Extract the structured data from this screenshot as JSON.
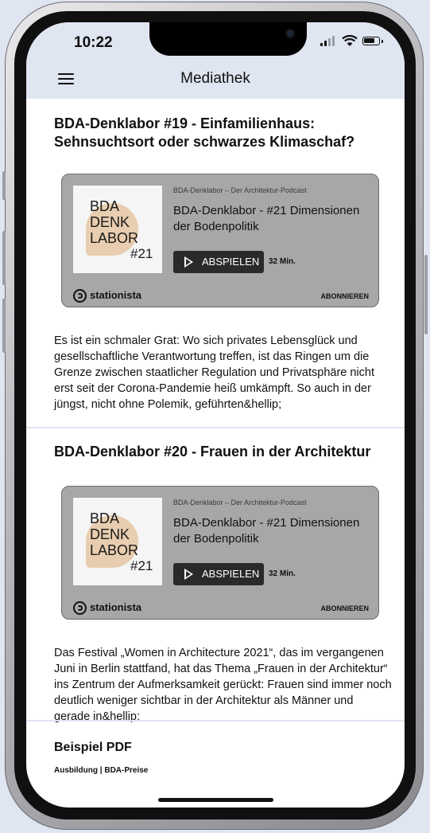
{
  "status_bar": {
    "time": "10:22",
    "battery_level": 0.75
  },
  "nav": {
    "title": "Mediathek",
    "menu_icon": "hamburger-menu-icon"
  },
  "podcast_embed": {
    "subtitle": "BDA-Denklabor – Der Architektur-Podcast",
    "episode_title": "BDA-Denklabor - #21 Dimensionen der Bodenpolitik",
    "cover_lines": [
      "BDA",
      "DENK",
      "LABOR"
    ],
    "cover_number": "#21",
    "play_label": "ABSPIELEN",
    "duration": "32 Min.",
    "brand": "stationista",
    "subscribe_label": "ABONNIEREN"
  },
  "articles": [
    {
      "title": "BDA-Denklabor #19  - Einfamilienhaus: Sehnsuchtsort oder schwarzes Klimaschaf?",
      "excerpt": "Es ist ein schmaler Grat: Wo sich privates Lebensglück und gesellschaftliche Verantwortung treffen, ist das Ringen um die Grenze zwischen staatlicher Regulation und Privatsphäre nicht erst seit der Corona-Pandemie heiß umkämpft. So auch in der jüngst, nicht ohne Polemik, geführten&hellip;"
    },
    {
      "title": "BDA-Denklabor #20 - Frauen in der Architektur",
      "excerpt": "Das Festival „Women in Architecture 2021“, das im vergangenen Juni in Berlin stattfand, hat das Thema „Frauen in der Architektur“ ins Zentrum der Aufmerksamkeit gerückt: Frauen sind immer noch deutlich weniger sichtbar in der Architektur als Männer und gerade in&hellip;"
    }
  ],
  "pdf_item": {
    "title": "Beispiel PDF",
    "meta": "Ausbildung | BDA-Preise"
  },
  "colors": {
    "topbar": "#dfe5f1",
    "embed_bg": "#a7a7a7",
    "cover_accent": "#e8cdb0",
    "play_button": "#2a2a2a"
  }
}
